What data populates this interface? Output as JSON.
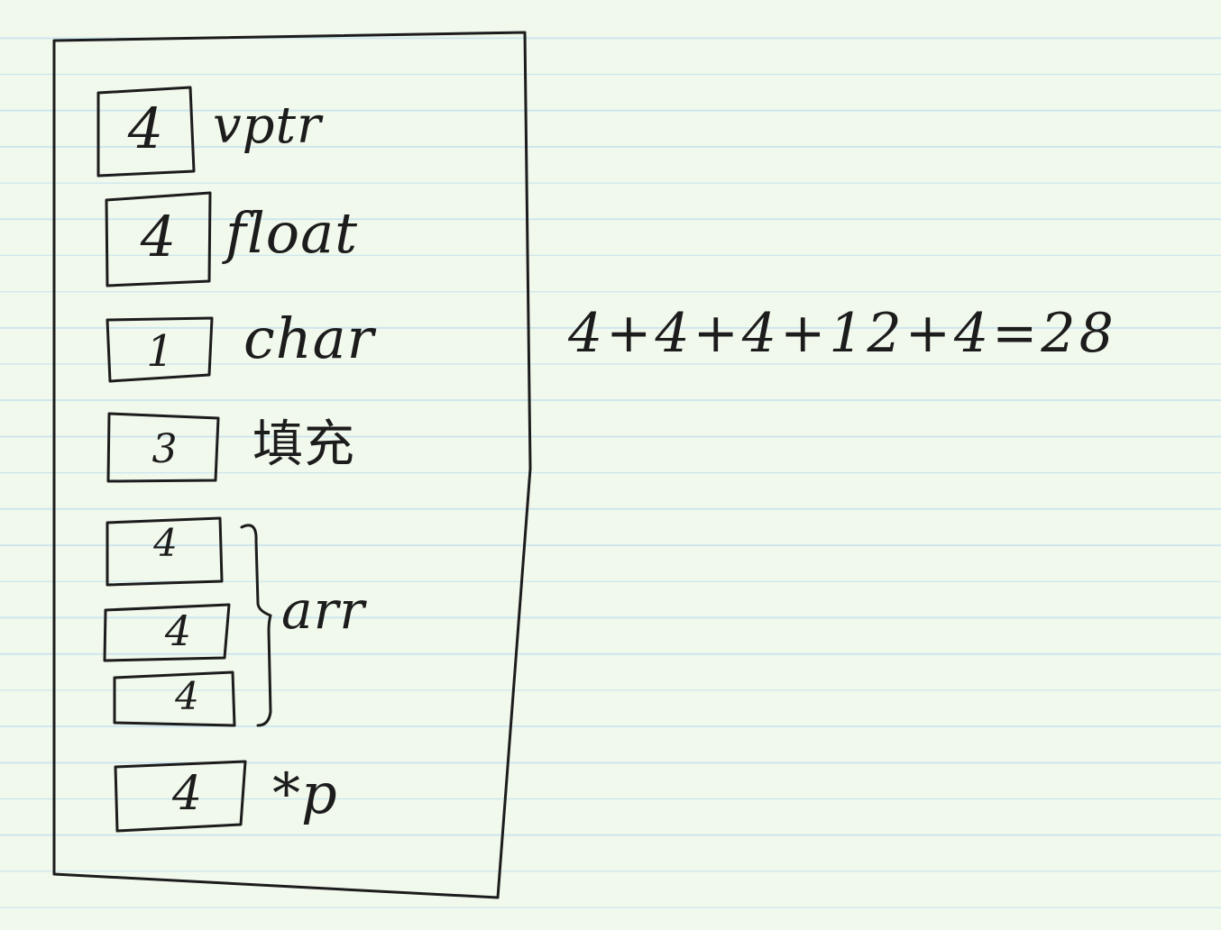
{
  "diagram": {
    "fields": [
      {
        "size": "4",
        "label": "vptr"
      },
      {
        "size": "4",
        "label": "float"
      },
      {
        "size": "1",
        "label": "char"
      },
      {
        "size": "3",
        "label": "填充"
      },
      {
        "size": "4",
        "label": ""
      },
      {
        "size": "4",
        "label": ""
      },
      {
        "size": "4",
        "label": ""
      },
      {
        "size": "4",
        "label": "*p"
      }
    ],
    "group_label": "arr",
    "equation": "4+4+4+12+4=28"
  }
}
